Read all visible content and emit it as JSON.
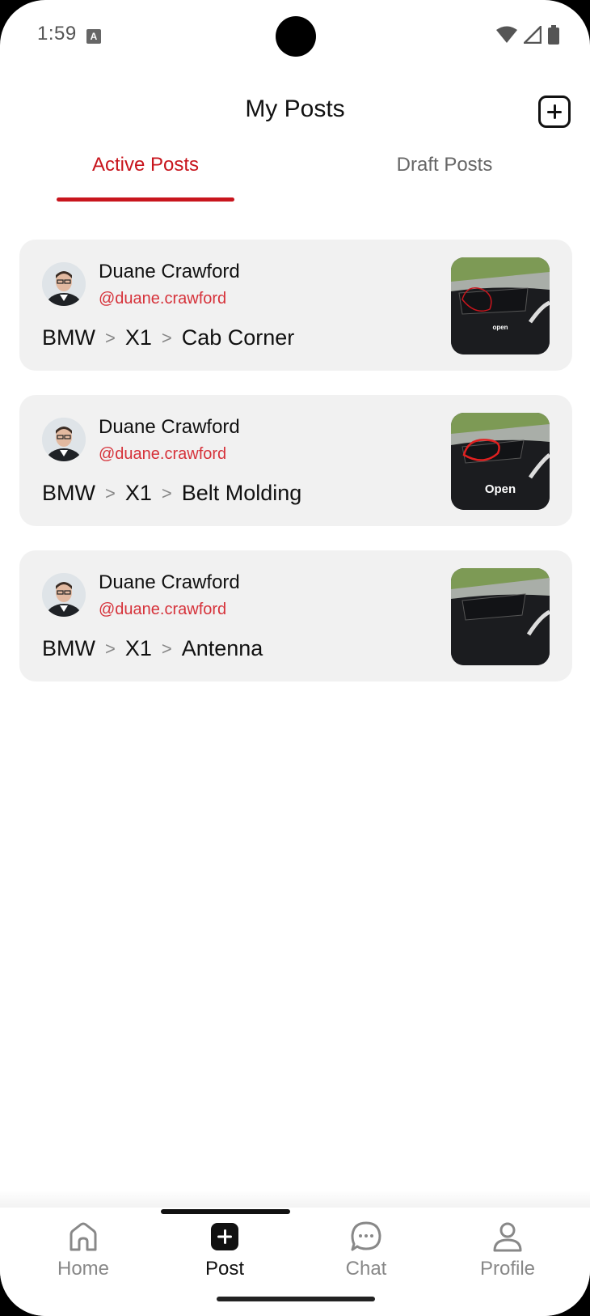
{
  "status_bar": {
    "time": "1:59",
    "a_icon": "A"
  },
  "header": {
    "title": "My Posts",
    "add_icon": "plus-square-icon"
  },
  "tabs": [
    {
      "label": "Active Posts",
      "active": true
    },
    {
      "label": "Draft Posts",
      "active": false
    }
  ],
  "posts": [
    {
      "name": "Duane Crawford",
      "handle": "@duane.crawford",
      "make": "BMW",
      "model": "X1",
      "part": "Cab Corner",
      "thumb_label": "open",
      "separator": ">"
    },
    {
      "name": "Duane Crawford",
      "handle": "@duane.crawford",
      "make": "BMW",
      "model": "X1",
      "part": "Belt Molding",
      "thumb_label": "Open",
      "separator": ">"
    },
    {
      "name": "Duane Crawford",
      "handle": "@duane.crawford",
      "make": "BMW",
      "model": "X1",
      "part": "Antenna",
      "thumb_label": "",
      "separator": ">"
    }
  ],
  "nav": [
    {
      "label": "Home",
      "icon": "home-icon",
      "active": false
    },
    {
      "label": "Post",
      "icon": "post-icon",
      "active": true
    },
    {
      "label": "Chat",
      "icon": "chat-icon",
      "active": false
    },
    {
      "label": "Profile",
      "icon": "profile-icon",
      "active": false
    }
  ],
  "colors": {
    "accent": "#c8151d",
    "handle": "#d6323a",
    "card_bg": "#f1f1f1",
    "text": "#111111",
    "muted": "#888888"
  }
}
